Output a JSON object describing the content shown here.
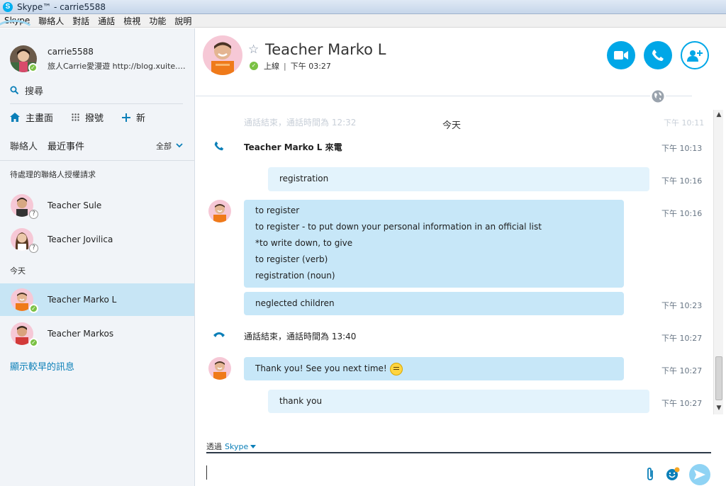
{
  "window": {
    "title": "Skype™ - carrie5588"
  },
  "menu": [
    "Skype",
    "聯絡人",
    "對話",
    "通話",
    "檢視",
    "功能",
    "說明"
  ],
  "profile": {
    "name": "carrie5588",
    "mood": "旅人Carrie愛漫遊 http://blog.xuite.n..."
  },
  "search": {
    "label": "搜尋"
  },
  "nav": {
    "home": "主畫面",
    "dial": "撥號",
    "new": "新"
  },
  "tabs": {
    "contacts": "聯絡人",
    "recent": "最近事件",
    "filter": "全部"
  },
  "sections": {
    "pending": "待處理的聯絡人授權請求",
    "today": "今天"
  },
  "pending_contacts": [
    {
      "name": "Teacher Sule"
    },
    {
      "name": "Teacher Jovilica"
    }
  ],
  "today_contacts": [
    {
      "name": "Teacher Marko L"
    },
    {
      "name": "Teacher Markos"
    }
  ],
  "show_older": "顯示較早的訊息",
  "conversation": {
    "contact_name": "Teacher Marko L",
    "status": "上線",
    "local_time": "下午 03:27",
    "ghost_text": "通話結束，通話時間為 12:32",
    "ghost_time": "下午 10:11",
    "date_divider": "今天",
    "incoming_call": {
      "text": "Teacher Marko L 來電",
      "time": "下午 10:13"
    },
    "messages": [
      {
        "lines": [
          "registration"
        ],
        "time": "下午 10:16"
      },
      {
        "lines": [
          "to register",
          "to register - to put down your personal information in an official list",
          "*to write down, to give",
          "to register (verb)",
          "registration (noun)"
        ],
        "time": "下午 10:16"
      },
      {
        "lines": [
          "neglected children"
        ],
        "time": "下午 10:23"
      },
      {
        "lines": [
          "Thank you! See you next time!"
        ],
        "time": "下午 10:27"
      },
      {
        "lines": [
          "thank you"
        ],
        "time": "下午 10:27"
      }
    ],
    "call_ended": {
      "text": "通話結束，通話時間為 13:40",
      "time": "下午 10:27"
    }
  },
  "composer": {
    "via_label": "透過",
    "via_service": "Skype"
  },
  "colors": {
    "accent": "#00a7e7",
    "bubble": "#c7e7f8",
    "bubble_light": "#e3f3fc",
    "online": "#7ac143",
    "link": "#0b7fb8"
  }
}
